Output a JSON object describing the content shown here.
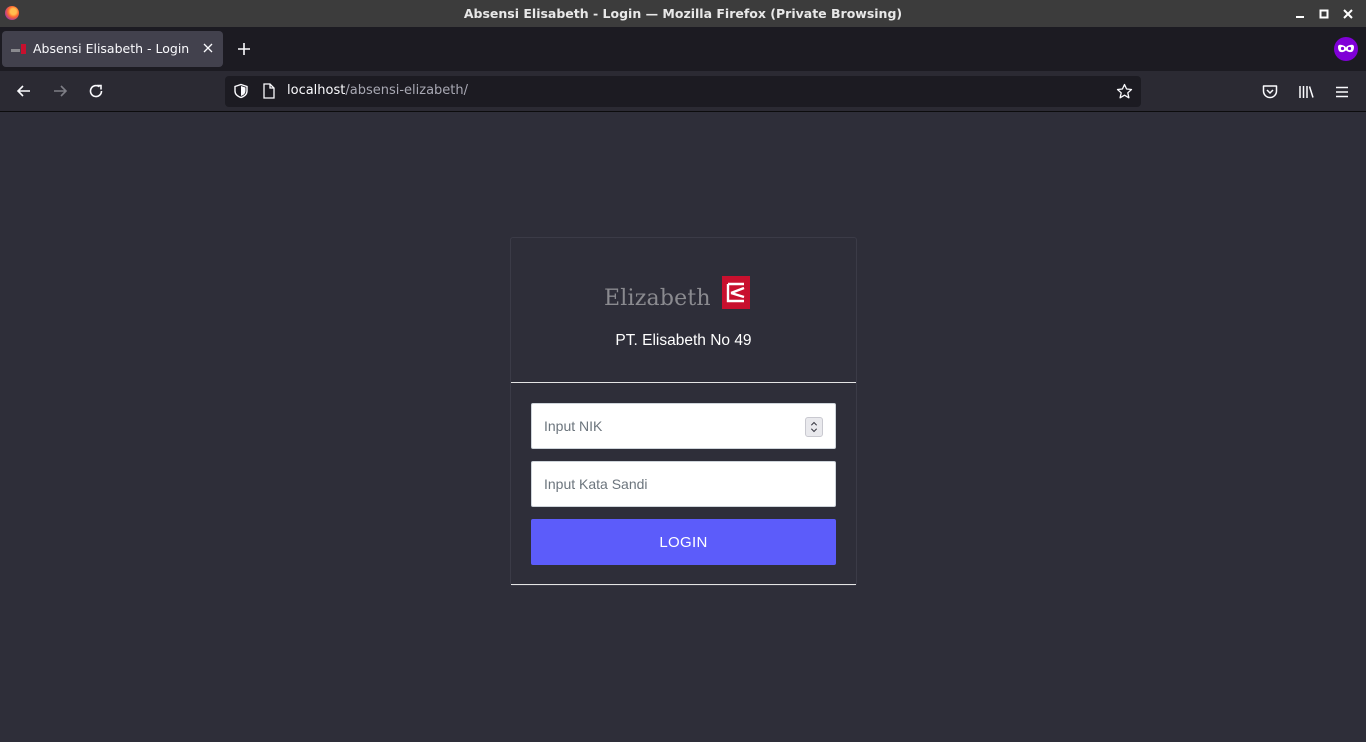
{
  "window": {
    "title": "Absensi Elisabeth - Login — Mozilla Firefox (Private Browsing)"
  },
  "tabs": [
    {
      "label": "Absensi Elisabeth - Login",
      "active": true
    }
  ],
  "urlbar": {
    "host": "localhost",
    "path": "/absensi-elizabeth/"
  },
  "login_card": {
    "logo_text": "Elizabeth",
    "company_name": "PT. Elisabeth No 49",
    "nik_placeholder": "Input NIK",
    "password_placeholder": "Input Kata Sandi",
    "login_label": "LOGIN"
  },
  "colors": {
    "page_background": "#2e2e39",
    "login_button": "#5c5cfa",
    "logo_mark": "#c8102e",
    "private_badge": "#8000d7"
  },
  "icons": [
    "firefox-icon",
    "minimize-icon",
    "maximize-icon",
    "close-icon",
    "tab-favicon",
    "tab-close-icon",
    "new-tab-icon",
    "private-browsing-icon",
    "back-icon",
    "forward-icon",
    "reload-icon",
    "shield-icon",
    "page-icon",
    "bookmark-star-icon",
    "pocket-icon",
    "library-icon",
    "menu-icon",
    "number-spinner-icon"
  ]
}
